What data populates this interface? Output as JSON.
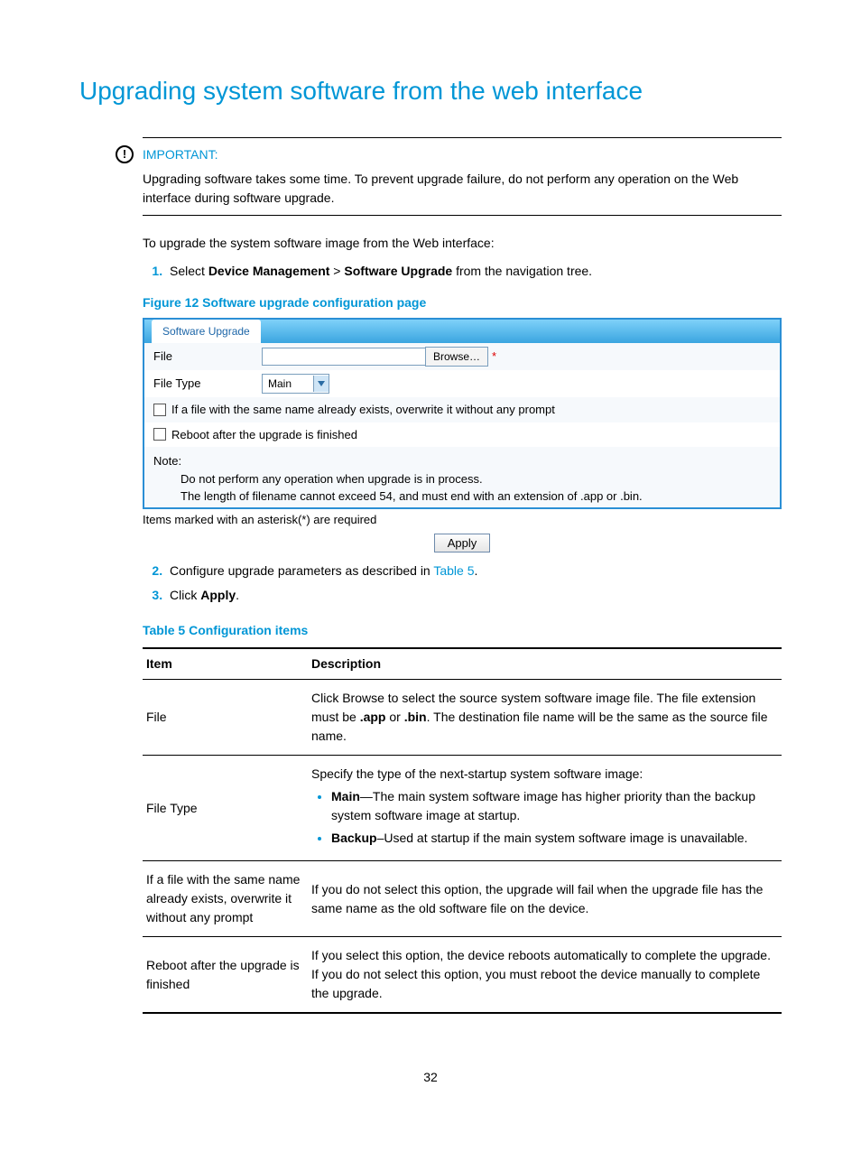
{
  "title": "Upgrading system software from the web interface",
  "important": {
    "label": "IMPORTANT:",
    "text": "Upgrading software takes some time. To prevent upgrade failure, do not perform any operation on the Web interface during software upgrade."
  },
  "intro": "To upgrade the system software image from the Web interface:",
  "step1_prefix": "Select ",
  "step1_b1": "Device Management",
  "step1_gt": " > ",
  "step1_b2": "Software Upgrade",
  "step1_suffix": " from the navigation tree.",
  "figure_caption": "Figure 12 Software upgrade configuration page",
  "form": {
    "tab": "Software Upgrade",
    "file_label": "File",
    "browse": "Browse…",
    "filetype_label": "File Type",
    "filetype_value": "Main",
    "cb1": "If a file with the same name already exists, overwrite it without any prompt",
    "cb2": "Reboot after the upgrade is finished",
    "note_label": "Note:",
    "note_line1": "Do not perform any operation when upgrade is in process.",
    "note_line2": "The length of filename cannot exceed 54, and must end with an extension of .app or .bin.",
    "footer": "Items marked with an asterisk(*) are required",
    "apply": "Apply"
  },
  "step2_prefix": "Configure upgrade parameters as described in ",
  "step2_link": "Table 5",
  "step2_suffix": ".",
  "step3_prefix": "Click ",
  "step3_bold": "Apply",
  "step3_suffix": ".",
  "table_caption": "Table 5 Configuration items",
  "table": {
    "h1": "Item",
    "h2": "Description",
    "r1c1": "File",
    "r1_t1": "Click Browse to select the source system software image file. The file extension must be ",
    "r1_b1": ".app",
    "r1_t2": " or ",
    "r1_b2": ".bin",
    "r1_t3": ". The destination file name will be the same as the source file name.",
    "r2c1": "File Type",
    "r2_intro": "Specify the type of the next-startup system software image:",
    "r2_li1_b": "Main",
    "r2_li1_t": "—The main system software image has higher priority than the backup system software image at startup.",
    "r2_li2_b": "Backup",
    "r2_li2_t": "–Used at startup if the main system software image is unavailable.",
    "r3c1": "If a file with the same name already exists, overwrite it without any prompt",
    "r3c2": "If you do not select this option, the upgrade will fail when the upgrade file has the same name as the old software file on the device.",
    "r4c1": "Reboot after the upgrade is finished",
    "r4c2": "If you select this option, the device reboots automatically to complete the upgrade. If you do not select this option, you must reboot the device manually to complete the upgrade."
  },
  "page_number": "32",
  "chart_data": {
    "type": "table",
    "title": "Table 5 Configuration items",
    "columns": [
      "Item",
      "Description"
    ],
    "rows": [
      [
        "File",
        "Click Browse to select the source system software image file. The file extension must be .app or .bin. The destination file name will be the same as the source file name."
      ],
      [
        "File Type",
        "Specify the type of the next-startup system software image: Main—The main system software image has higher priority than the backup system software image at startup. Backup–Used at startup if the main system software image is unavailable."
      ],
      [
        "If a file with the same name already exists, overwrite it without any prompt",
        "If you do not select this option, the upgrade will fail when the upgrade file has the same name as the old software file on the device."
      ],
      [
        "Reboot after the upgrade is finished",
        "If you select this option, the device reboots automatically to complete the upgrade. If you do not select this option, you must reboot the device manually to complete the upgrade."
      ]
    ]
  }
}
